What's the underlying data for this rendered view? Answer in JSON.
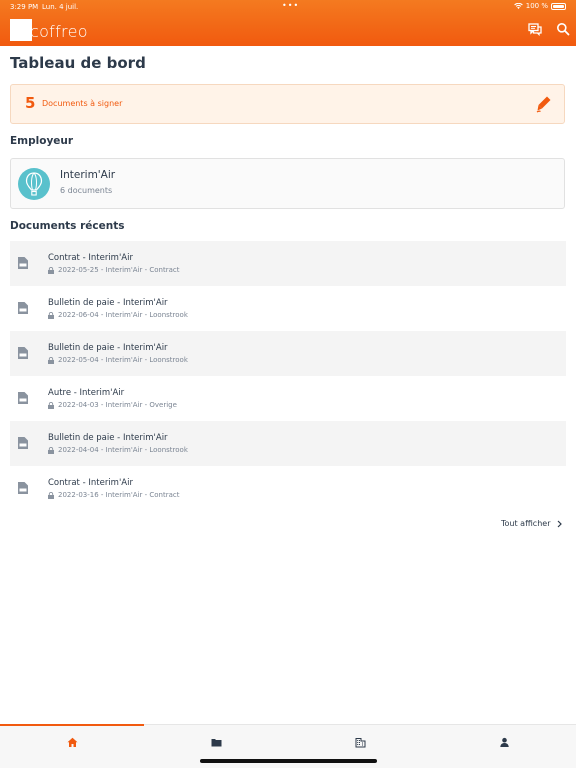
{
  "status": {
    "time": "3:29 PM",
    "date": "Lun. 4 juil.",
    "battery": "100 %"
  },
  "app": {
    "logo_text": "coffreo"
  },
  "page": {
    "title": "Tableau de bord"
  },
  "sign_card": {
    "count": "5",
    "label": "Documents à signer"
  },
  "employer_section": {
    "title": "Employeur"
  },
  "employer": {
    "name": "Interim'Air",
    "subtitle": "6 documents"
  },
  "recent_section": {
    "title": "Documents récents"
  },
  "documents": [
    {
      "title": "Contrat - Interim'Air",
      "meta": "2022-05-25 - Interim'Air - Contract"
    },
    {
      "title": "Bulletin de paie - Interim'Air",
      "meta": "2022-06-04 - Interim'Air - Loonstrook"
    },
    {
      "title": "Bulletin de paie - Interim'Air",
      "meta": "2022-05-04 - Interim'Air - Loonstrook"
    },
    {
      "title": "Autre - Interim'Air",
      "meta": "2022-04-03 - Interim'Air - Overige"
    },
    {
      "title": "Bulletin de paie - Interim'Air",
      "meta": "2022-04-04 - Interim'Air - Loonstrook"
    },
    {
      "title": "Contrat - Interim'Air",
      "meta": "2022-03-16 - Interim'Air - Contract"
    }
  ],
  "see_all": {
    "label": "Tout afficher"
  },
  "tabs": [
    {
      "icon": "home-icon",
      "active": true
    },
    {
      "icon": "folder-icon",
      "active": false
    },
    {
      "icon": "building-icon",
      "active": false
    },
    {
      "icon": "person-icon",
      "active": false
    }
  ],
  "colors": {
    "brand": "#f15a0f",
    "text": "#2d3a4a",
    "muted": "#7b8593",
    "avatar": "#59c1cc",
    "sign_bg": "#fff3e8"
  }
}
